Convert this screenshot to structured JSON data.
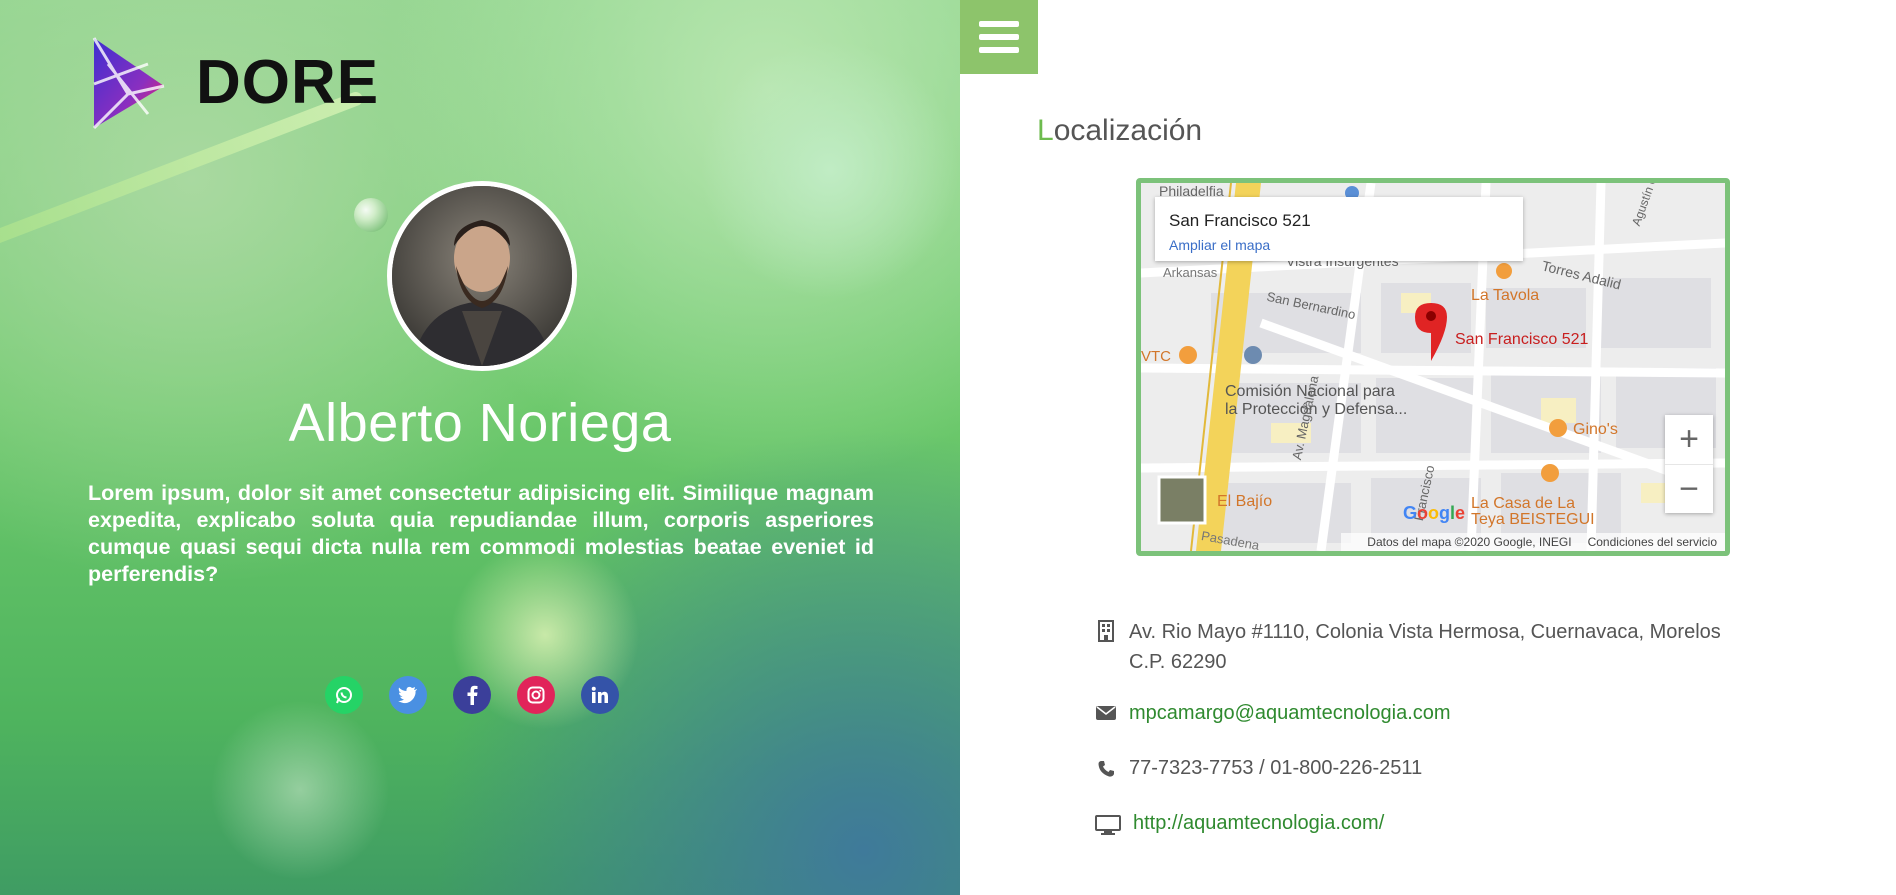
{
  "brand": {
    "name": "DORE"
  },
  "profile": {
    "name": "Alberto Noriega",
    "bio": "Lorem ipsum, dolor sit amet consectetur adipisicing elit. Similique magnam expedita, explicabo soluta quia repudiandae illum, corporis asperiores cumque quasi sequi dicta nulla rem commodi molestias beatae eveniet id perferendis?"
  },
  "socials": [
    {
      "name": "whatsapp",
      "icon": "whatsapp-icon",
      "color": "#25d366"
    },
    {
      "name": "twitter",
      "icon": "twitter-icon",
      "color": "#4a90e2"
    },
    {
      "name": "facebook",
      "icon": "facebook-icon",
      "color": "#3b3f9a"
    },
    {
      "name": "instagram",
      "icon": "instagram-icon",
      "color": "#e1245a"
    },
    {
      "name": "linkedin",
      "icon": "linkedin-icon",
      "color": "#3453a8"
    }
  ],
  "section": {
    "title_first": "L",
    "title_rest": "ocalización"
  },
  "map": {
    "place_title": "San Francisco 521",
    "enlarge_link": "Ampliar el mapa",
    "marker_label": "San Francisco 521",
    "attribution": "Datos del mapa ©2020 Google, INEGI",
    "terms": "Condiciones del servicio",
    "logo": "Google",
    "labels": {
      "philadelphia": "Philadelfia",
      "insurgentes": "Vistra Insurgentes",
      "arkansas": "Arkansas",
      "torres_adalid": "Torres Adalid",
      "la_tavola": "La Tavola",
      "san_bernardino": "San Bernardino",
      "agustin": "Agustín González de C",
      "vtc": "VTC",
      "comision1": "Comisión Nacional para",
      "comision2": "la Protección y Defensa...",
      "ginos": "Gino's",
      "el_bajio": "El Bajío",
      "magdalena": "Av. Magdalena",
      "francisco": "Francisco",
      "casa1": "La Casa de La",
      "casa2": "Teya BEISTEGUI",
      "pasadena": "Pasadena"
    },
    "zoom_in": "+",
    "zoom_out": "−"
  },
  "contact": {
    "address": "Av. Rio Mayo #1110, Colonia Vista Hermosa, Cuernavaca, Morelos C.P. 62290",
    "email": "mpcamargo@aquamtecnologia.com",
    "phone": "77-7323-7753 / 01-800-226-2511",
    "website": "http://aquamtecnologia.com/"
  },
  "colors": {
    "accent": "#8dc46b",
    "link": "#2f8a2f",
    "map_border": "#7cc27a"
  }
}
